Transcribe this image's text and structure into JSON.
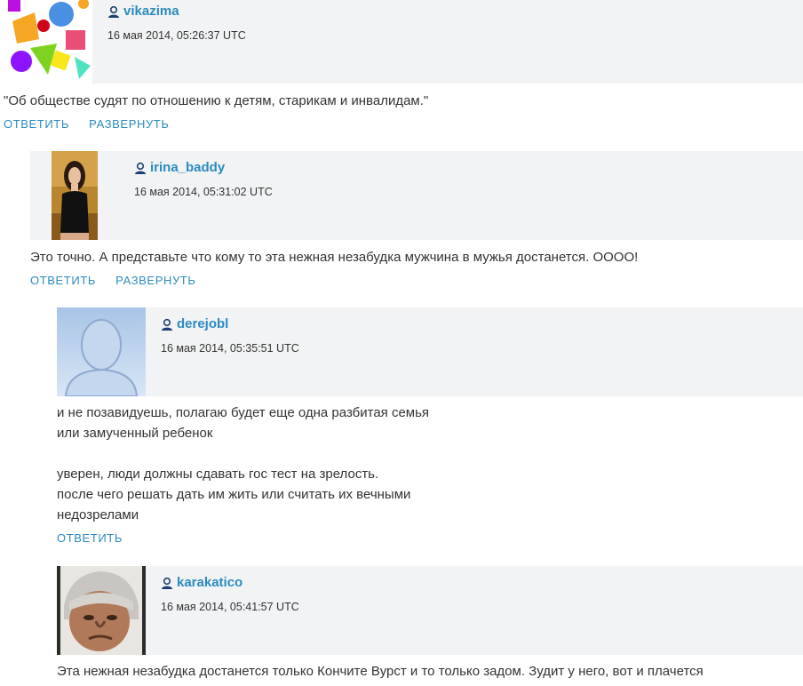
{
  "comments": [
    {
      "username": "vikazima",
      "date": "16 мая 2014, 05:26:37 UTC",
      "text": "\"Об обществе судят по отношению к детям, старикам и инвалидам.\"",
      "reply_label": "ОТВЕТИТЬ",
      "expand_label": "РАЗВЕРНУТЬ"
    },
    {
      "username": "irina_baddy",
      "date": "16 мая 2014, 05:31:02 UTC",
      "text": "Это точно. А представьте что кому то эта нежная незабудка мужчина в мужья достанется. ОООО!",
      "reply_label": "ОТВЕТИТЬ",
      "expand_label": "РАЗВЕРНУТЬ"
    },
    {
      "username": "derejobl",
      "date": "16 мая 2014, 05:35:51 UTC",
      "text": "и не позавидуешь, полагаю будет еще одна разбитая семья\nили замученный ребенок\n\nуверен, люди должны сдавать гос тест на зрелость.\nпосле чего решать дать им жить или считать их вечными\nнедозрелами",
      "reply_label": "ОТВЕТИТЬ"
    },
    {
      "username": "karakatico",
      "date": "16 мая 2014, 05:41:57 UTC",
      "text": "Эта нежная незабудка достанется только Кончите Вурст и то только задом. Зудит у него, вот и плачется"
    }
  ],
  "colors": {
    "link": "#2a8bbf",
    "header_bg": "#f2f3f4"
  },
  "icons": {
    "user_type": "user-icon"
  }
}
